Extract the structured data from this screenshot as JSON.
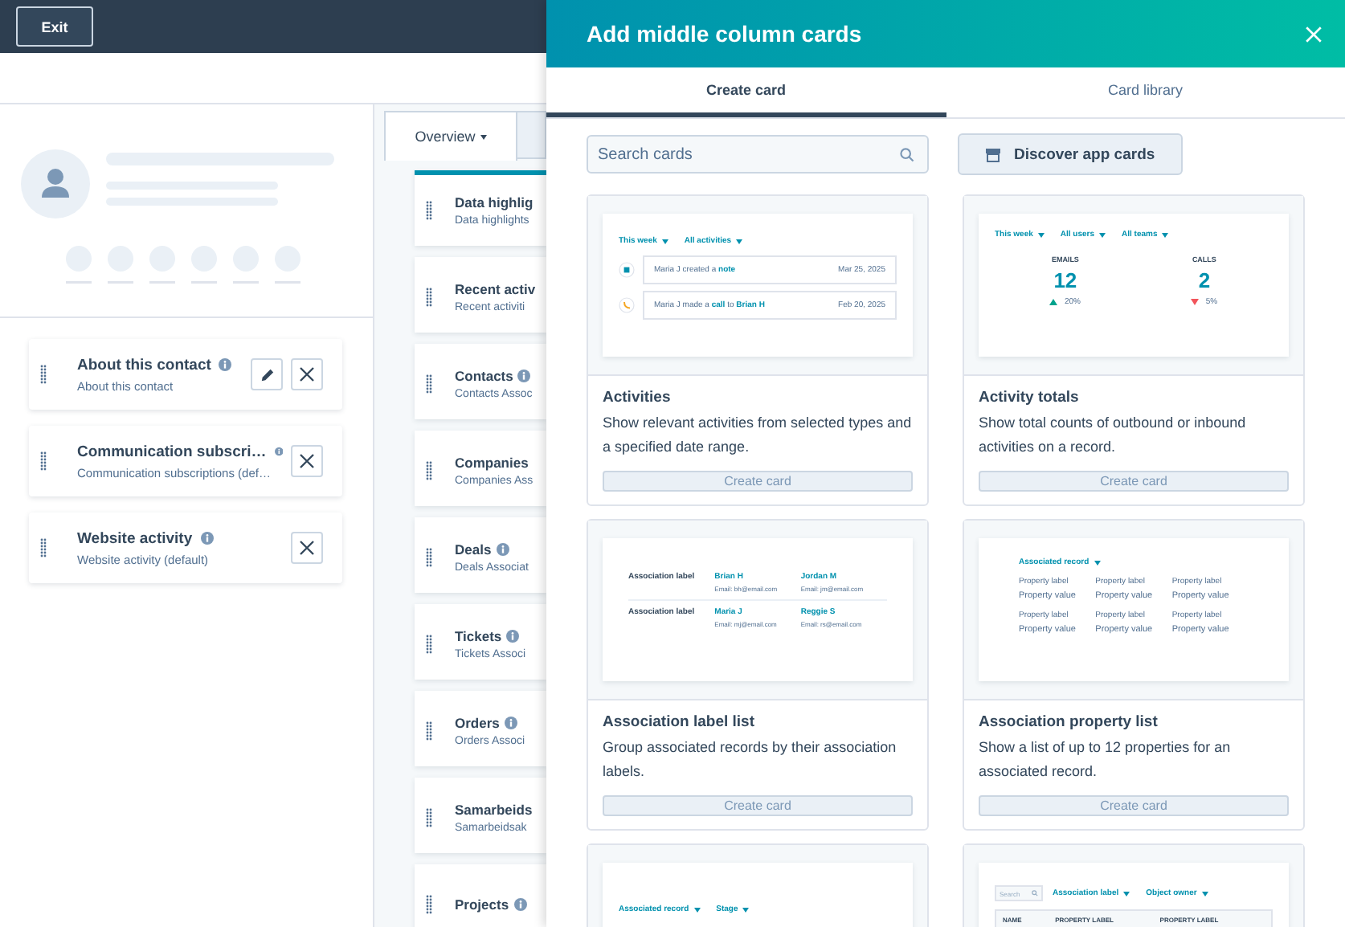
{
  "top_bar": {
    "exit_button": "Exit"
  },
  "left_cards": [
    {
      "title": "About this contact",
      "subtitle": "About this contact",
      "info": true,
      "editable": true
    },
    {
      "title": "Communication subscri…",
      "subtitle": "Communication subscriptions (def…",
      "info": true,
      "editable": false
    },
    {
      "title": "Website activity",
      "subtitle": "Website activity (default)",
      "info": true,
      "editable": false
    }
  ],
  "middle": {
    "view_tab": {
      "label": "Overview"
    },
    "cards": [
      {
        "title": "Data highlig",
        "subtitle": "Data highlights",
        "info": false,
        "highlighted": true
      },
      {
        "title": "Recent activ",
        "subtitle": "Recent activiti",
        "info": false,
        "highlighted": false
      },
      {
        "title": "Contacts",
        "subtitle": "Contacts Assoc",
        "info": true,
        "highlighted": false
      },
      {
        "title": "Companies",
        "subtitle": "Companies Ass",
        "info": false,
        "highlighted": false
      },
      {
        "title": "Deals",
        "subtitle": "Deals Associat",
        "info": true,
        "highlighted": false
      },
      {
        "title": "Tickets",
        "subtitle": "Tickets Associ",
        "info": true,
        "highlighted": false
      },
      {
        "title": "Orders",
        "subtitle": "Orders Associ",
        "info": true,
        "highlighted": false
      },
      {
        "title": "Samarbeids",
        "subtitle": "Samarbeidsak",
        "info": false,
        "highlighted": false
      },
      {
        "title": "Projects",
        "info": true,
        "highlighted": false
      }
    ]
  },
  "panel": {
    "title": "Add middle column cards",
    "tabs": [
      {
        "label": "Create card",
        "selected": true
      },
      {
        "label": "Card library",
        "selected": false
      }
    ],
    "search": {
      "placeholder": "Search cards"
    },
    "discover_button": "Discover app cards",
    "cards": [
      {
        "title": "Activities",
        "description": "Show relevant activities from selected types and a specified date range.",
        "button": "Create card",
        "preview": {
          "kind": "activities",
          "filters": [
            "This week",
            "All activities"
          ],
          "items": [
            {
              "kind": "note",
              "text": "Maria J created a **note**",
              "date": "Mar 25, 2025"
            },
            {
              "kind": "call",
              "text": "Maria J made a **call** to **Brian H**",
              "date": "Feb 20, 2025"
            }
          ]
        }
      },
      {
        "title": "Activity totals",
        "description": "Show total counts of outbound or inbound activities on a record.",
        "button": "Create card",
        "preview": {
          "kind": "totals",
          "filters": [
            "This week",
            "All users",
            "All teams"
          ],
          "stats": [
            {
              "label": "EMAILS",
              "value": "12",
              "kind": "up",
              "change": "20%"
            },
            {
              "label": "CALLS",
              "value": "2",
              "kind": "down",
              "change": "5%"
            }
          ]
        }
      },
      {
        "title": "Association label list",
        "description": "Group associated records by their association labels.",
        "button": "Create card",
        "preview": {
          "kind": "label_list",
          "rows": [
            {
              "label": "Association label",
              "records": [
                {
                  "name": "Brian H",
                  "email": "Email: bh@email.com"
                },
                {
                  "name": "Jordan M",
                  "email": "Email: jm@email.com"
                }
              ]
            },
            {
              "label": "Association label",
              "records": [
                {
                  "name": "Maria J",
                  "email": "Email: mj@email.com"
                },
                {
                  "name": "Reggie S",
                  "email": "Email: rs@email.com"
                }
              ]
            }
          ]
        }
      },
      {
        "title": "Association property list",
        "description": "Show a list of up to 12 properties for an associated record.",
        "button": "Create card",
        "preview": {
          "kind": "property_list",
          "filters": [
            "Associated record"
          ],
          "properties": [
            {
              "label": "Property label",
              "value": "Property value"
            },
            {
              "label": "Property label",
              "value": "Property value"
            },
            {
              "label": "Property label",
              "value": "Property value"
            },
            {
              "label": "Property label",
              "value": "Property value"
            },
            {
              "label": "Property label",
              "value": "Property value"
            },
            {
              "label": "Property label",
              "value": "Property value"
            }
          ]
        }
      },
      {
        "preview": {
          "kind": "filters",
          "filters": [
            "Associated record",
            "Stage"
          ]
        }
      },
      {
        "preview": {
          "kind": "table",
          "search": {
            "placeholder": "Search"
          },
          "filters": [
            "Association label",
            "Object owner"
          ],
          "columns": [
            "NAME",
            "PROPERTY LABEL",
            "PROPERTY LABEL"
          ]
        }
      }
    ]
  }
}
